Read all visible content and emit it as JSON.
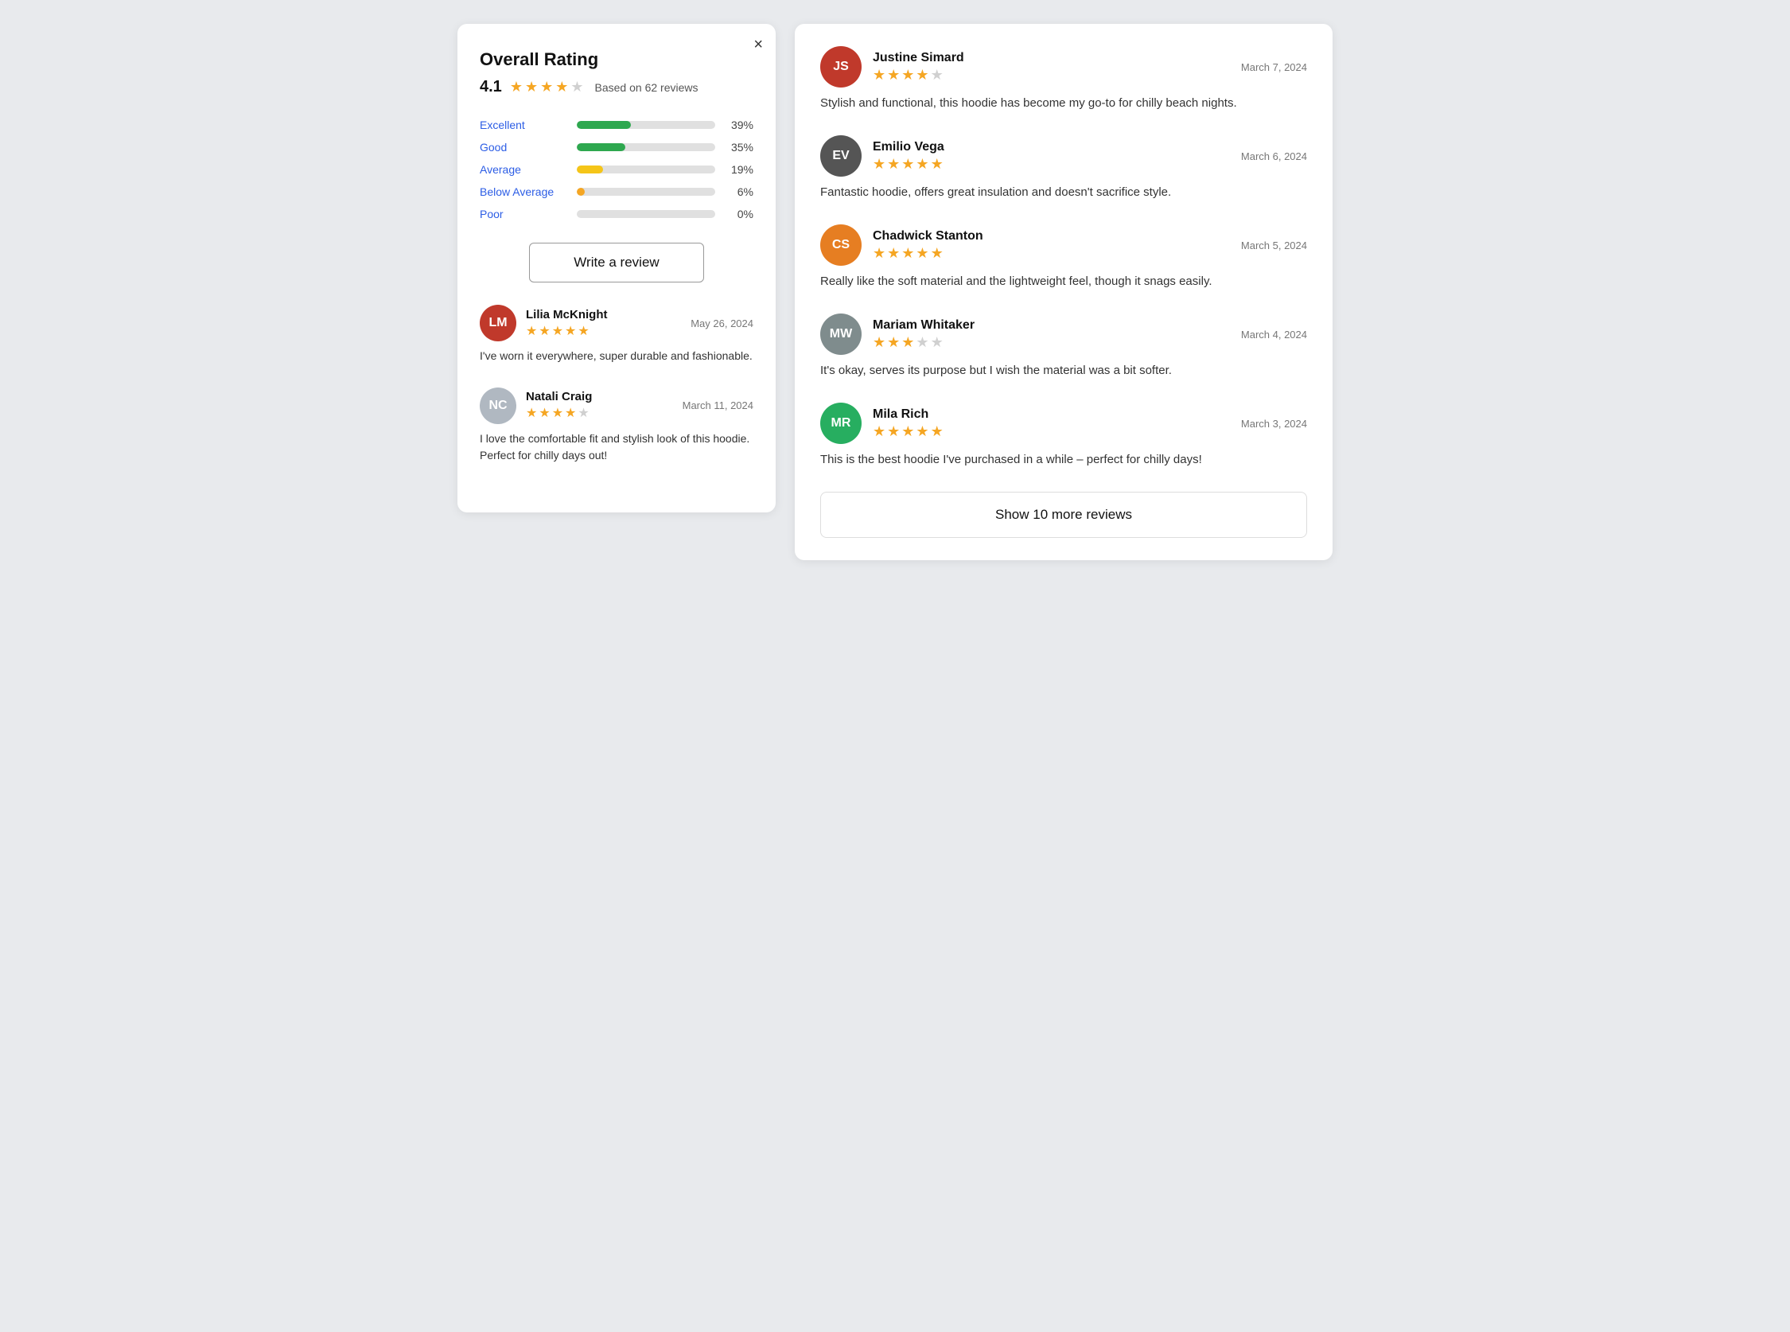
{
  "left": {
    "title": "Overall Rating",
    "rating": "4.1",
    "based_on": "Based on 62 reviews",
    "stars": [
      true,
      true,
      true,
      true,
      false
    ],
    "bars": [
      {
        "label": "Excellent",
        "pct": 39,
        "pct_label": "39%",
        "color": "#2ea84f"
      },
      {
        "label": "Good",
        "pct": 35,
        "pct_label": "35%",
        "color": "#2ea84f"
      },
      {
        "label": "Average",
        "pct": 19,
        "pct_label": "19%",
        "color": "#f5c518"
      },
      {
        "label": "Below Average",
        "pct": 6,
        "pct_label": "6%",
        "color": "#f5a623"
      },
      {
        "label": "Poor",
        "pct": 0,
        "pct_label": "0%",
        "color": "#d0d0d0"
      }
    ],
    "write_review": "Write a review",
    "reviews": [
      {
        "name": "Lilia McKnight",
        "date": "May 26, 2024",
        "stars": [
          true,
          true,
          true,
          true,
          true
        ],
        "text": "I've worn it everywhere, super durable and fashionable.",
        "avatar_type": "image",
        "avatar_color": "#c0392b",
        "initials": "LM"
      },
      {
        "name": "Natali Craig",
        "date": "March 11, 2024",
        "stars": [
          true,
          true,
          true,
          true,
          false
        ],
        "text": "I love the comfortable fit and stylish look of this hoodie. Perfect for chilly days out!",
        "avatar_type": "initials",
        "avatar_color": "#b0b8c1",
        "initials": "NC"
      }
    ]
  },
  "right": {
    "reviews": [
      {
        "name": "Justine Simard",
        "date": "March 7, 2024",
        "stars": [
          true,
          true,
          true,
          true,
          false
        ],
        "text": "Stylish and functional, this hoodie has become my go-to for chilly beach nights.",
        "avatar_color": "#c0392b",
        "initials": "JS"
      },
      {
        "name": "Emilio Vega",
        "date": "March 6, 2024",
        "stars": [
          true,
          true,
          true,
          true,
          true
        ],
        "text": "Fantastic hoodie, offers great insulation and doesn't sacrifice style.",
        "avatar_color": "#555",
        "initials": "EV"
      },
      {
        "name": "Chadwick Stanton",
        "date": "March 5, 2024",
        "stars": [
          true,
          true,
          true,
          true,
          true
        ],
        "text": "Really like the soft material and the lightweight feel, though it snags easily.",
        "avatar_color": "#e67e22",
        "initials": "CS"
      },
      {
        "name": "Mariam Whitaker",
        "date": "March 4, 2024",
        "stars": [
          true,
          true,
          true,
          false,
          false
        ],
        "text": "It's okay, serves its purpose but I wish the material was a bit softer.",
        "avatar_color": "#7f8c8d",
        "initials": "MW"
      },
      {
        "name": "Mila Rich",
        "date": "March 3, 2024",
        "stars": [
          true,
          true,
          true,
          true,
          true
        ],
        "text": "This is the best hoodie I've purchased in a while – perfect for chilly days!",
        "avatar_color": "#27ae60",
        "initials": "MR"
      }
    ],
    "show_more": "Show 10 more reviews"
  },
  "close_label": "×"
}
